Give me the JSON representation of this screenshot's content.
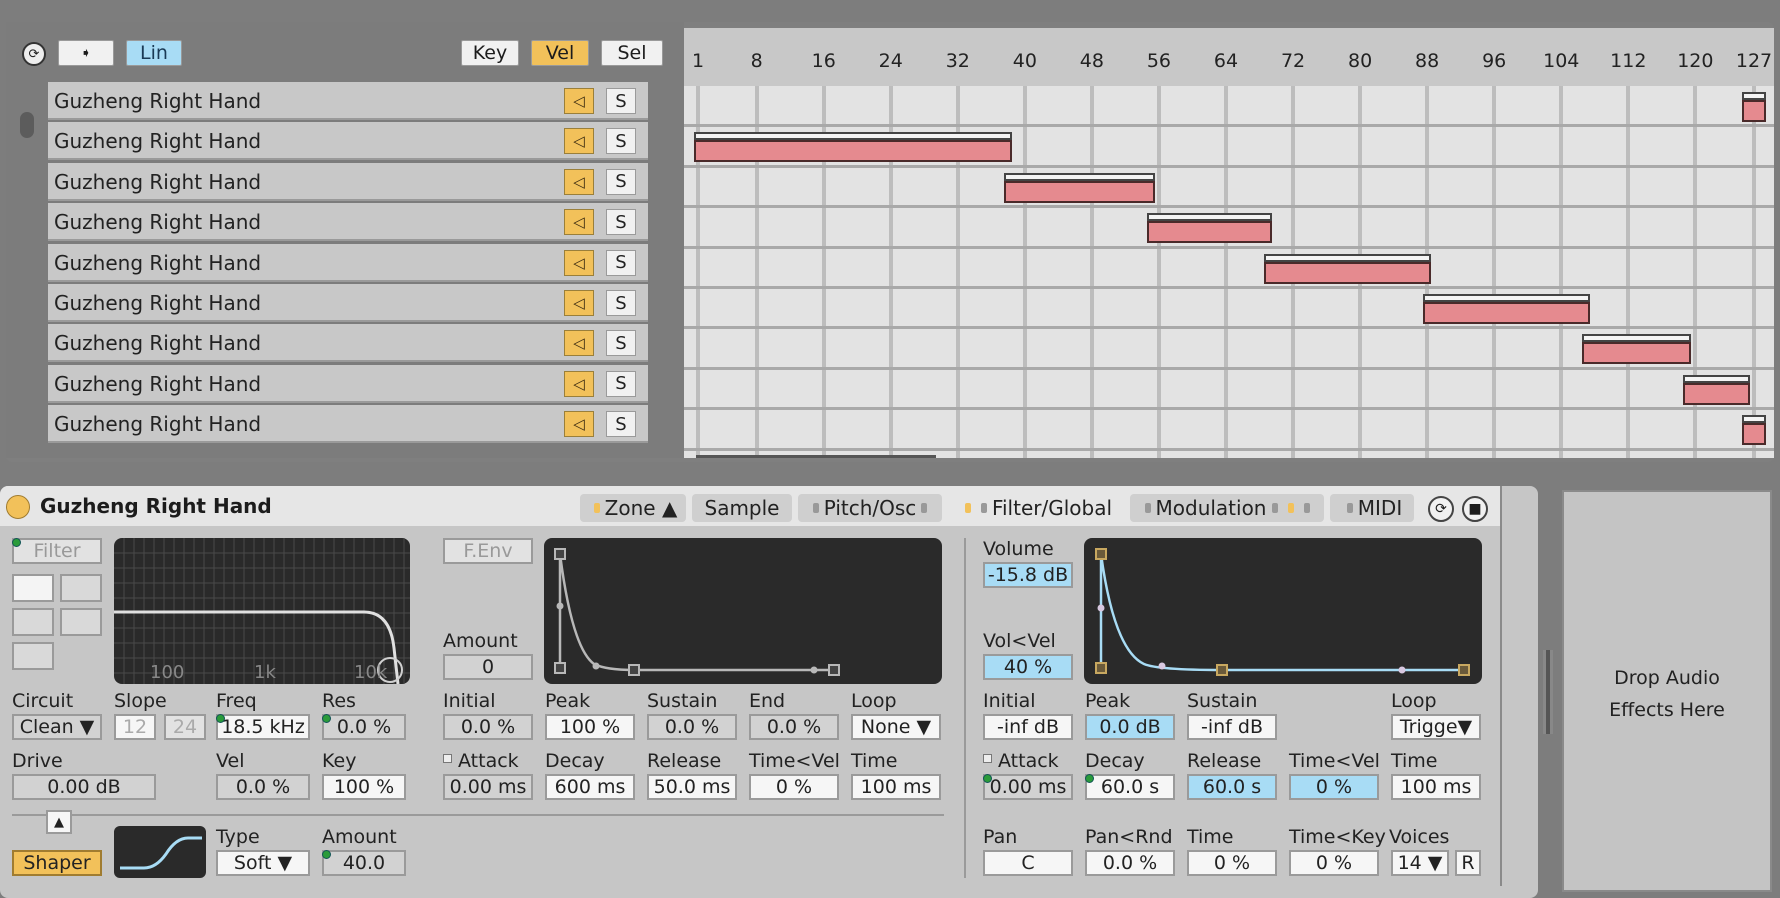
{
  "zone_editor": {
    "header": {
      "cycle_icon": "cycle-icon",
      "arrow_button_icon": "arrow-right-icon",
      "lin_label": "Lin",
      "key_label": "Key",
      "vel_label": "Vel",
      "sel_label": "Sel"
    },
    "zones": [
      {
        "name": "Guzheng Right Hand",
        "vel_low": 127,
        "vel_high": 127
      },
      {
        "name": "Guzheng Right Hand",
        "vel_low": 1,
        "vel_high": 38
      },
      {
        "name": "Guzheng Right Hand",
        "vel_low": 38,
        "vel_high": 55
      },
      {
        "name": "Guzheng Right Hand",
        "vel_low": 55,
        "vel_high": 69
      },
      {
        "name": "Guzheng Right Hand",
        "vel_low": 69,
        "vel_high": 88
      },
      {
        "name": "Guzheng Right Hand",
        "vel_low": 88,
        "vel_high": 107
      },
      {
        "name": "Guzheng Right Hand",
        "vel_low": 107,
        "vel_high": 119
      },
      {
        "name": "Guzheng Right Hand",
        "vel_low": 119,
        "vel_high": 126
      },
      {
        "name": "Guzheng Right Hand",
        "vel_low": 127,
        "vel_high": 127
      }
    ],
    "solo_label": "S",
    "ruler_ticks": [
      "1",
      "8",
      "16",
      "24",
      "32",
      "40",
      "48",
      "56",
      "64",
      "72",
      "80",
      "88",
      "96",
      "104",
      "112",
      "120",
      "127"
    ],
    "ruler_values": [
      1,
      8,
      16,
      24,
      32,
      40,
      48,
      56,
      64,
      72,
      80,
      88,
      96,
      104,
      112,
      120,
      127
    ],
    "ruler_range": [
      1,
      127
    ]
  },
  "device": {
    "title": "Guzheng Right Hand",
    "tabs": [
      {
        "label": "Zone ▲",
        "active": false
      },
      {
        "label": "Sample",
        "active": false
      },
      {
        "label": "Pitch/Osc",
        "active": false
      },
      {
        "label": "Filter/Global",
        "active": true
      },
      {
        "label": "Modulation",
        "active": false
      },
      {
        "label": "MIDI",
        "active": false
      }
    ],
    "filter": {
      "toggle_label": "Filter",
      "graph_labels": [
        "100",
        "1k",
        "10k"
      ],
      "circuit_label": "Circuit",
      "circuit_value": "Clean ▼",
      "slope_label": "Slope",
      "slope_12": "12",
      "slope_24": "24",
      "freq_label": "Freq",
      "freq_value": "18.5 kHz",
      "res_label": "Res",
      "res_value": "0.0 %",
      "drive_label": "Drive",
      "drive_value": "0.00 dB",
      "vel_label": "Vel",
      "vel_value": "0.0 %",
      "key_label": "Key",
      "key_value": "100 %"
    },
    "shaper": {
      "toggle_label": "Shaper",
      "type_label": "Type",
      "type_value": "Soft ▼",
      "amount_label": "Amount",
      "amount_value": "40.0"
    },
    "filter_env": {
      "toggle_label": "F.Env",
      "amount_label": "Amount",
      "amount_value": "0",
      "initial_label": "Initial",
      "initial_value": "0.0 %",
      "peak_label": "Peak",
      "peak_value": "100 %",
      "sustain_label": "Sustain",
      "sustain_value": "0.0 %",
      "end_label": "End",
      "end_value": "0.0 %",
      "loop_label": "Loop",
      "loop_value": "None ▼",
      "attack_label": "Attack",
      "attack_value": "0.00 ms",
      "decay_label": "Decay",
      "decay_value": "600 ms",
      "release_label": "Release",
      "release_value": "50.0 ms",
      "timevel_label": "Time<Vel",
      "timevel_value": "0 %",
      "time_label": "Time",
      "time_value": "100 ms"
    },
    "amp": {
      "volume_label": "Volume",
      "volume_value": "-15.8 dB",
      "volvel_label": "Vol<Vel",
      "volvel_value": "40 %",
      "initial_label": "Initial",
      "initial_value": "-inf dB",
      "peak_label": "Peak",
      "peak_value": "0.0 dB",
      "sustain_label": "Sustain",
      "sustain_value": "-inf dB",
      "loop_label": "Loop",
      "loop_value": "Trigge▼",
      "attack_label": "Attack",
      "attack_value": "0.00 ms",
      "decay_label": "Decay",
      "decay_value": "60.0 s",
      "release_label": "Release",
      "release_value": "60.0 s",
      "timevel_label": "Time<Vel",
      "timevel_value": "0 %",
      "time_label": "Time",
      "time_value": "100 ms",
      "pan_label": "Pan",
      "pan_value": "C",
      "panrnd_label": "Pan<Rnd",
      "panrnd_value": "0.0 %",
      "gtime_label": "Time",
      "gtime_value": "0 %",
      "timekey_label": "Time<Key",
      "timekey_value": "0 %",
      "voices_label": "Voices",
      "voices_value": "14 ▼",
      "retrigger_label": "R"
    }
  },
  "drop_zone": {
    "text_line1": "Drop Audio",
    "text_line2": "Effects Here"
  },
  "colors": {
    "accent_yellow": "#f2c15a",
    "accent_blue": "#a8dcf5",
    "zone_bar": "#e58a8f"
  }
}
